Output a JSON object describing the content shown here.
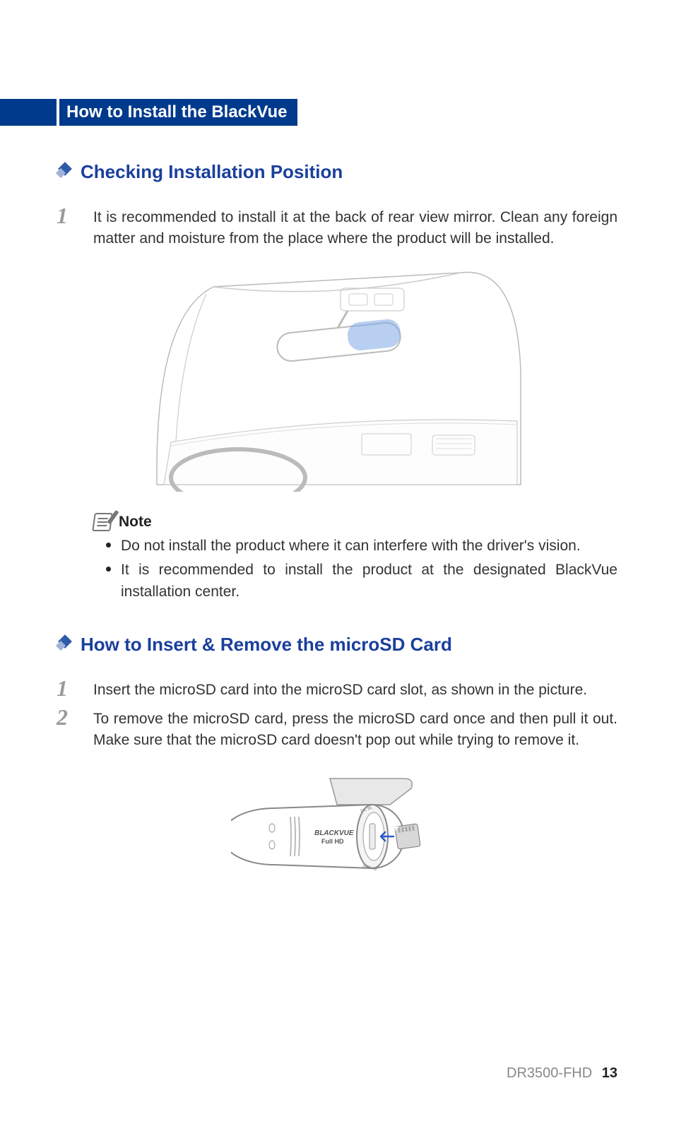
{
  "header": {
    "title": "How to Install the BlackVue"
  },
  "section1": {
    "title": "Checking Installation Position",
    "step1": {
      "num": "1",
      "text": "It is recommended to install it at the back of rear view mirror. Clean any foreign matter and moisture from the place where the product will be installed."
    },
    "note": {
      "label": "Note",
      "items": [
        "Do not install the product where it can interfere with the driver's vision.",
        "It is recommended to install the product at the designated BlackVue installation center."
      ]
    }
  },
  "section2": {
    "title": "How to Insert & Remove the microSD Card",
    "step1": {
      "num": "1",
      "text": "Insert the microSD card into the microSD card slot, as shown in the picture."
    },
    "step2": {
      "num": "2",
      "text": "To remove the microSD card, press the microSD card once and then pull it out. Make sure that the microSD card doesn't pop out while trying to remove it."
    },
    "device_labels": {
      "brand": "BLACKVUE",
      "res": "Full HD",
      "dc": "DC IN",
      "gps": "GPS IN"
    }
  },
  "footer": {
    "model": "DR3500-FHD",
    "page": "13"
  }
}
